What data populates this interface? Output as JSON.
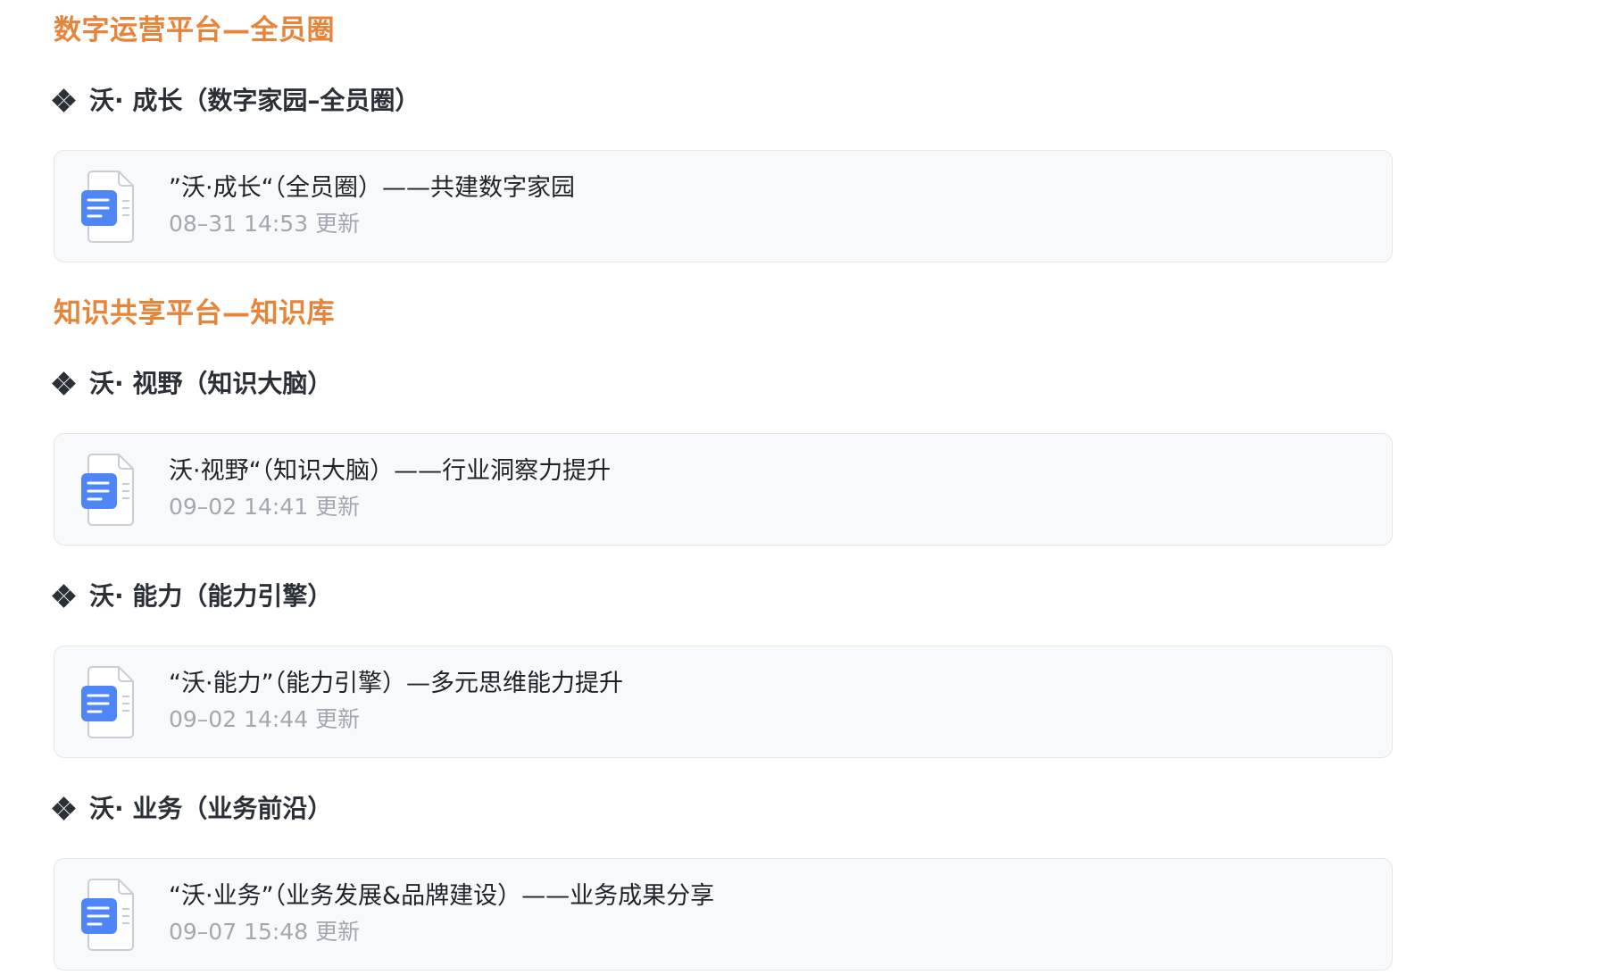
{
  "sections": [
    {
      "title": "数字运营平台—全员圈",
      "groups": [
        {
          "heading": "沃· 成长（数字家园–全员圈）",
          "doc": {
            "title": "”沃·成长“（全员圈）——共建数字家园",
            "updated": "08–31 14:53 更新"
          }
        }
      ]
    },
    {
      "title": "知识共享平台—知识库",
      "groups": [
        {
          "heading": "沃· 视野（知识大脑）",
          "doc": {
            "title": "沃·视野“（知识大脑）——行业洞察力提升",
            "updated": "09–02 14:41 更新"
          }
        },
        {
          "heading": "沃· 能力（能力引擎）",
          "doc": {
            "title": "“沃·能力”（能力引擎）—多元思维能力提升",
            "updated": "09–02 14:44 更新"
          }
        },
        {
          "heading": "沃· 业务（业务前沿）",
          "doc": {
            "title": "“沃·业务”（业务发展&品牌建设）——业务成果分享",
            "updated": "09–07 15:48 更新"
          }
        }
      ]
    }
  ],
  "icons": {
    "bullet": "diamond-bullet-icon",
    "doc": "document-icon"
  },
  "colors": {
    "section_title": "#e8833a",
    "card_bg": "#f8f9fb",
    "card_border": "#e4e6ea",
    "doc_icon_blue": "#4f86f7",
    "meta_text": "#a3a8b0"
  }
}
